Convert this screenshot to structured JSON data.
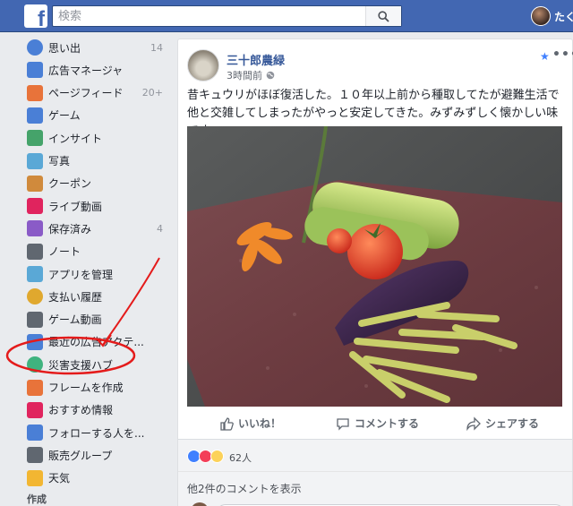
{
  "topbar": {
    "logo": "f",
    "search_placeholder": "検索",
    "username": "たく",
    "brand_color": "#4267b2"
  },
  "sidebar": {
    "items": [
      {
        "label": "思い出",
        "count": "14",
        "icon": "memories-icon",
        "color": "#4a7fd6"
      },
      {
        "label": "広告マネージャ",
        "count": "",
        "icon": "ads-manager-icon",
        "color": "#4a7fd6"
      },
      {
        "label": "ページフィード",
        "count": "20+",
        "icon": "pages-feed-icon",
        "color": "#e8733a"
      },
      {
        "label": "ゲーム",
        "count": "",
        "icon": "games-icon",
        "color": "#4a7fd6"
      },
      {
        "label": "インサイト",
        "count": "",
        "icon": "insights-icon",
        "color": "#45a36a"
      },
      {
        "label": "写真",
        "count": "",
        "icon": "photos-icon",
        "color": "#5aa8d6"
      },
      {
        "label": "クーポン",
        "count": "",
        "icon": "coupons-icon",
        "color": "#d08a3c"
      },
      {
        "label": "ライブ動画",
        "count": "",
        "icon": "live-video-icon",
        "color": "#e0245e"
      },
      {
        "label": "保存済み",
        "count": "4",
        "icon": "saved-icon",
        "color": "#8a5bc7"
      },
      {
        "label": "ノート",
        "count": "",
        "icon": "notes-icon",
        "color": "#606770"
      },
      {
        "label": "アプリを管理",
        "count": "",
        "icon": "apps-icon",
        "color": "#5aa8d6"
      },
      {
        "label": "支払い履歴",
        "count": "",
        "icon": "payment-icon",
        "color": "#e0a82e"
      },
      {
        "label": "ゲーム動画",
        "count": "",
        "icon": "game-video-icon",
        "color": "#606770"
      },
      {
        "label": "最近の広告アクテ...",
        "count": "",
        "icon": "recent-ads-icon",
        "color": "#4a7fd6"
      },
      {
        "label": "災害支援ハブ",
        "count": "",
        "icon": "crisis-response-icon",
        "color": "#3fb37f"
      },
      {
        "label": "フレームを作成",
        "count": "",
        "icon": "frame-icon",
        "color": "#e8733a"
      },
      {
        "label": "おすすめ情報",
        "count": "",
        "icon": "recommendations-icon",
        "color": "#e0245e"
      },
      {
        "label": "フォローする人を...",
        "count": "",
        "icon": "find-friends-icon",
        "color": "#4a7fd6"
      },
      {
        "label": "販売グループ",
        "count": "",
        "icon": "sell-groups-icon",
        "color": "#606770"
      },
      {
        "label": "天気",
        "count": "",
        "icon": "weather-icon",
        "color": "#f2b632"
      }
    ],
    "section_title": "作成"
  },
  "post": {
    "author": "三十郎農緑",
    "time": "3時間前",
    "text": "昔キュウリがほぼ復活した。１０年以上前から種取してたが避難生活で他と交雑してしまったがやっと安定してきた。みずみずしく懐かしい味です。",
    "actions": {
      "like": "いいね！",
      "comment": "コメントする",
      "share": "シェアする"
    },
    "reaction_count": "62人",
    "more_comments": "他2件のコメントを表示",
    "accent_color": "#365899"
  },
  "annotation": {
    "color": "#e41b1b"
  }
}
